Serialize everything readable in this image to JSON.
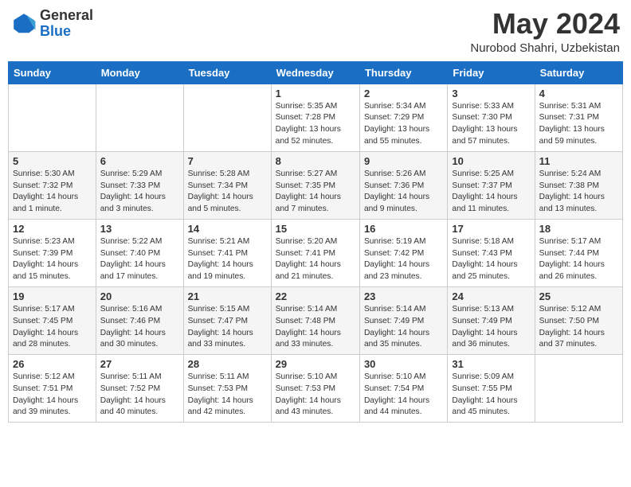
{
  "logo": {
    "general": "General",
    "blue": "Blue"
  },
  "header": {
    "month": "May 2024",
    "location": "Nurobod Shahri, Uzbekistan"
  },
  "weekdays": [
    "Sunday",
    "Monday",
    "Tuesday",
    "Wednesday",
    "Thursday",
    "Friday",
    "Saturday"
  ],
  "weeks": [
    [
      {
        "day": "",
        "info": ""
      },
      {
        "day": "",
        "info": ""
      },
      {
        "day": "",
        "info": ""
      },
      {
        "day": "1",
        "info": "Sunrise: 5:35 AM\nSunset: 7:28 PM\nDaylight: 13 hours\nand 52 minutes."
      },
      {
        "day": "2",
        "info": "Sunrise: 5:34 AM\nSunset: 7:29 PM\nDaylight: 13 hours\nand 55 minutes."
      },
      {
        "day": "3",
        "info": "Sunrise: 5:33 AM\nSunset: 7:30 PM\nDaylight: 13 hours\nand 57 minutes."
      },
      {
        "day": "4",
        "info": "Sunrise: 5:31 AM\nSunset: 7:31 PM\nDaylight: 13 hours\nand 59 minutes."
      }
    ],
    [
      {
        "day": "5",
        "info": "Sunrise: 5:30 AM\nSunset: 7:32 PM\nDaylight: 14 hours\nand 1 minute."
      },
      {
        "day": "6",
        "info": "Sunrise: 5:29 AM\nSunset: 7:33 PM\nDaylight: 14 hours\nand 3 minutes."
      },
      {
        "day": "7",
        "info": "Sunrise: 5:28 AM\nSunset: 7:34 PM\nDaylight: 14 hours\nand 5 minutes."
      },
      {
        "day": "8",
        "info": "Sunrise: 5:27 AM\nSunset: 7:35 PM\nDaylight: 14 hours\nand 7 minutes."
      },
      {
        "day": "9",
        "info": "Sunrise: 5:26 AM\nSunset: 7:36 PM\nDaylight: 14 hours\nand 9 minutes."
      },
      {
        "day": "10",
        "info": "Sunrise: 5:25 AM\nSunset: 7:37 PM\nDaylight: 14 hours\nand 11 minutes."
      },
      {
        "day": "11",
        "info": "Sunrise: 5:24 AM\nSunset: 7:38 PM\nDaylight: 14 hours\nand 13 minutes."
      }
    ],
    [
      {
        "day": "12",
        "info": "Sunrise: 5:23 AM\nSunset: 7:39 PM\nDaylight: 14 hours\nand 15 minutes."
      },
      {
        "day": "13",
        "info": "Sunrise: 5:22 AM\nSunset: 7:40 PM\nDaylight: 14 hours\nand 17 minutes."
      },
      {
        "day": "14",
        "info": "Sunrise: 5:21 AM\nSunset: 7:41 PM\nDaylight: 14 hours\nand 19 minutes."
      },
      {
        "day": "15",
        "info": "Sunrise: 5:20 AM\nSunset: 7:41 PM\nDaylight: 14 hours\nand 21 minutes."
      },
      {
        "day": "16",
        "info": "Sunrise: 5:19 AM\nSunset: 7:42 PM\nDaylight: 14 hours\nand 23 minutes."
      },
      {
        "day": "17",
        "info": "Sunrise: 5:18 AM\nSunset: 7:43 PM\nDaylight: 14 hours\nand 25 minutes."
      },
      {
        "day": "18",
        "info": "Sunrise: 5:17 AM\nSunset: 7:44 PM\nDaylight: 14 hours\nand 26 minutes."
      }
    ],
    [
      {
        "day": "19",
        "info": "Sunrise: 5:17 AM\nSunset: 7:45 PM\nDaylight: 14 hours\nand 28 minutes."
      },
      {
        "day": "20",
        "info": "Sunrise: 5:16 AM\nSunset: 7:46 PM\nDaylight: 14 hours\nand 30 minutes."
      },
      {
        "day": "21",
        "info": "Sunrise: 5:15 AM\nSunset: 7:47 PM\nDaylight: 14 hours\nand 33 minutes."
      },
      {
        "day": "22",
        "info": "Sunrise: 5:14 AM\nSunset: 7:48 PM\nDaylight: 14 hours\nand 33 minutes."
      },
      {
        "day": "23",
        "info": "Sunrise: 5:14 AM\nSunset: 7:49 PM\nDaylight: 14 hours\nand 35 minutes."
      },
      {
        "day": "24",
        "info": "Sunrise: 5:13 AM\nSunset: 7:49 PM\nDaylight: 14 hours\nand 36 minutes."
      },
      {
        "day": "25",
        "info": "Sunrise: 5:12 AM\nSunset: 7:50 PM\nDaylight: 14 hours\nand 37 minutes."
      }
    ],
    [
      {
        "day": "26",
        "info": "Sunrise: 5:12 AM\nSunset: 7:51 PM\nDaylight: 14 hours\nand 39 minutes."
      },
      {
        "day": "27",
        "info": "Sunrise: 5:11 AM\nSunset: 7:52 PM\nDaylight: 14 hours\nand 40 minutes."
      },
      {
        "day": "28",
        "info": "Sunrise: 5:11 AM\nSunset: 7:53 PM\nDaylight: 14 hours\nand 42 minutes."
      },
      {
        "day": "29",
        "info": "Sunrise: 5:10 AM\nSunset: 7:53 PM\nDaylight: 14 hours\nand 43 minutes."
      },
      {
        "day": "30",
        "info": "Sunrise: 5:10 AM\nSunset: 7:54 PM\nDaylight: 14 hours\nand 44 minutes."
      },
      {
        "day": "31",
        "info": "Sunrise: 5:09 AM\nSunset: 7:55 PM\nDaylight: 14 hours\nand 45 minutes."
      },
      {
        "day": "",
        "info": ""
      }
    ]
  ]
}
